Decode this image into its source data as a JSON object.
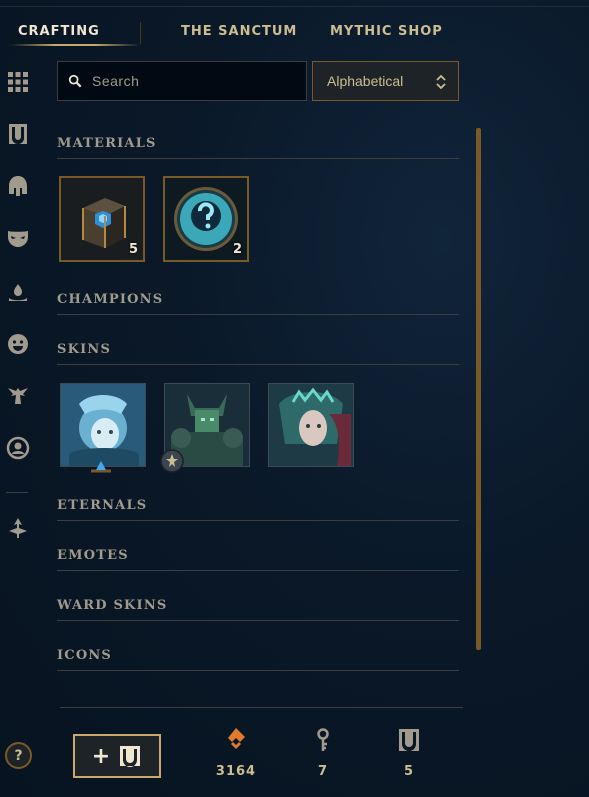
{
  "nav": {
    "tabs": [
      {
        "label": "CRAFTING"
      },
      {
        "label": "THE SANCTUM"
      },
      {
        "label": "MYTHIC SHOP"
      }
    ]
  },
  "sidebar": {
    "icons": [
      "grid-icon",
      "chest-icon",
      "helmet-icon",
      "mask-icon",
      "ward-icon",
      "emote-face-icon",
      "eternals-icon",
      "profile-icon",
      "arrow-icon"
    ]
  },
  "search": {
    "placeholder": "Search",
    "value": ""
  },
  "sort": {
    "selected": "Alphabetical"
  },
  "sections": {
    "materials": "MATERIALS",
    "champions": "CHAMPIONS",
    "skins": "SKINS",
    "eternals": "ETERNALS",
    "emotes": "EMOTES",
    "ward_skins": "WARD SKINS",
    "icons": "ICONS"
  },
  "materials": [
    {
      "icon": "hextech-chest-icon",
      "count": "5"
    },
    {
      "icon": "mystery-orb-icon",
      "count": "2"
    }
  ],
  "skins": [
    {
      "icon": "skin-shard-1"
    },
    {
      "icon": "skin-shard-2"
    },
    {
      "icon": "skin-shard-3"
    }
  ],
  "bottom": {
    "help": "?",
    "add_label": "+",
    "orange_essence": "3164",
    "keys": "7",
    "chests": "5"
  },
  "colors": {
    "gold": "#c8aa6e",
    "dark_gold": "#785a28",
    "text": "#a09b8c",
    "background": "#0a1828",
    "orange": "#e07a2e"
  }
}
